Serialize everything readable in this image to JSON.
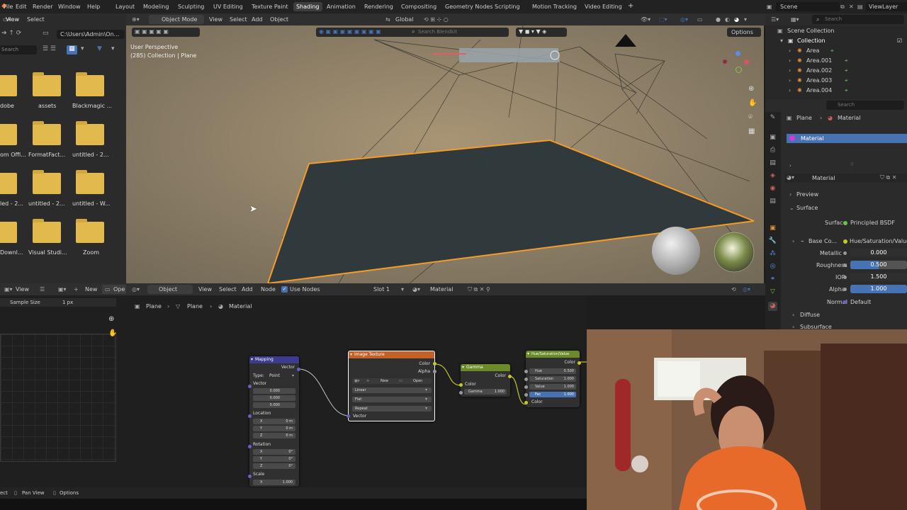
{
  "topbar": {
    "menus": [
      "File",
      "Edit",
      "Render",
      "Window",
      "Help"
    ],
    "tabs": [
      "Layout",
      "Modeling",
      "Sculpting",
      "UV Editing",
      "Texture Paint",
      "Shading",
      "Animation",
      "Rendering",
      "Compositing",
      "Geometry Nodes",
      "Scripting",
      "Motion Tracking",
      "Video Editing"
    ],
    "active_tab": "Shading",
    "add_tab": "+",
    "scene": "Scene",
    "view_layer": "ViewLayer"
  },
  "filebrowser": {
    "header_menus": [
      "View",
      "Select"
    ],
    "path": "C:\\Users\\Admin\\On...",
    "search_placeholder": "Search",
    "folders": [
      "dobe",
      "assets",
      "Blackmagic ...",
      "om Offi...",
      "FormatFact...",
      "untitled - 2...",
      "led - 2...",
      "untitled - 2...",
      "untitled - W...",
      "Downl...",
      "Visual Studi...",
      "Zoom"
    ]
  },
  "viewport": {
    "mode": "Object Mode",
    "menus": [
      "View",
      "Select",
      "Add",
      "Object"
    ],
    "transform": "Global",
    "perspective": "User Perspective",
    "collection_info": "(285) Collection | Plane",
    "search_placeholder": "Search Blendkit",
    "options": "Options"
  },
  "outliner": {
    "search_placeholder": "Search",
    "scene_collection": "Scene Collection",
    "collection": "Collection",
    "items": [
      "Area",
      "Area.001",
      "Area.002",
      "Area.003",
      "Area.004"
    ]
  },
  "properties": {
    "breadcrumb": [
      "Plane",
      "Material"
    ],
    "slot": "Material",
    "material_name": "Material",
    "preview": "Preview",
    "surface_section": "Surface",
    "surface_label": "Surface",
    "surface_value": "Principled BSDF",
    "base_color_label": "Base Co...",
    "base_color_value": "Hue/Saturation/Value",
    "metallic_label": "Metallic",
    "metallic": "0.000",
    "roughness_label": "Roughness",
    "roughness": "0.500",
    "roughness_fill": 0.5,
    "ior_label": "IOR",
    "ior": "1.500",
    "alpha_label": "Alpha",
    "alpha": "1.000",
    "alpha_fill": 1.0,
    "normal_label": "Normal",
    "normal": "Default",
    "diffuse": "Diffuse",
    "subsurface": "Subsurface"
  },
  "left_editor": {
    "menus": [
      "View",
      "New",
      "Ope"
    ],
    "sample_size_label": "Sample Size",
    "sample_size": "1 px"
  },
  "node_editor": {
    "type": "Object",
    "menus": [
      "View",
      "Select",
      "Add",
      "Node"
    ],
    "use_nodes": "Use Nodes",
    "slot": "Slot 1",
    "material": "Material",
    "breadcrumb": [
      "Plane",
      "Plane",
      "Material"
    ],
    "mapping": {
      "title": "Mapping",
      "out_vector": "Vector",
      "type_label": "Type:",
      "type_value": "Point",
      "vector_label": "Vector",
      "vector_vals": [
        "0.000",
        "0.000",
        "0.000"
      ],
      "location_label": "Location",
      "location": [
        [
          "X",
          "0 m"
        ],
        [
          "Y",
          "0 m"
        ],
        [
          "Z",
          "0 m"
        ]
      ],
      "rotation_label": "Rotation",
      "rotation": [
        [
          "X",
          "0°"
        ],
        [
          "Y",
          "0°"
        ],
        [
          "Z",
          "0°"
        ]
      ],
      "scale_label": "Scale",
      "scale_x": [
        "X",
        "1.000"
      ]
    },
    "image_texture": {
      "title": "Image Texture",
      "out_color": "Color",
      "out_alpha": "Alpha",
      "new": "New",
      "open": "Open",
      "interp": "Linear",
      "proj": "Flat",
      "ext": "Repeat",
      "in_vector": "Vector"
    },
    "gamma": {
      "title": "Gamma",
      "out_color": "Color",
      "in_color": "Color",
      "gamma_label": "Gamma",
      "gamma": "1.000"
    },
    "hsv": {
      "title": "Hue/Saturation/Value",
      "out_color": "Color",
      "hue_label": "Hue",
      "hue": "0.500",
      "sat_label": "Saturation",
      "sat": "1.000",
      "val_label": "Value",
      "val": "1.000",
      "fac_label": "Fac",
      "fac": "1.000",
      "in_color": "Color"
    }
  },
  "statusbar": {
    "items": [
      "ect",
      "Pan View",
      "Options"
    ]
  },
  "colors": {
    "accent": "#4772b3",
    "selection": "#f39b2b",
    "folder": "#e1b94c",
    "mapping_header": "#3b3b8f",
    "texture_header": "#c0622a",
    "gamma_header": "#6b8a2a",
    "hsv_header": "#6b8a2a"
  }
}
